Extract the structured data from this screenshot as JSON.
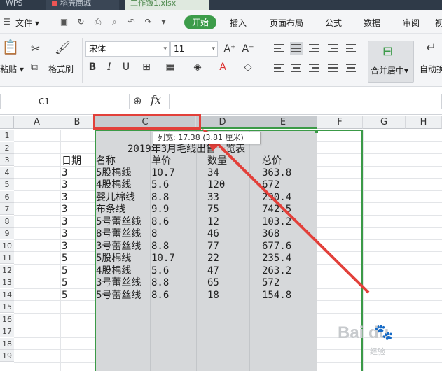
{
  "tabs": [
    {
      "label": "WPS"
    },
    {
      "label": "稻壳商城"
    },
    {
      "label": "工作簿1.xlsx"
    }
  ],
  "menu": {
    "file": "文件",
    "start": "开始",
    "insert": "插入",
    "page_layout": "页面布局",
    "formula": "公式",
    "data": "数据",
    "review": "审阅",
    "view": "视"
  },
  "ribbon": {
    "paste": "粘贴",
    "format_painter": "格式刷",
    "font_name": "宋体",
    "font_size": "11",
    "bold": "B",
    "italic": "I",
    "underline": "U",
    "merge_center": "合并居中",
    "auto_wrap": "自动换"
  },
  "formula_bar": {
    "name_box": "C1",
    "fx": "fx"
  },
  "columns": [
    "A",
    "B",
    "C",
    "D",
    "E",
    "F",
    "G",
    "H"
  ],
  "rows": [
    "1",
    "2",
    "3",
    "4",
    "5",
    "6",
    "7",
    "8",
    "9",
    "10",
    "11",
    "12",
    "13",
    "14",
    "15",
    "16",
    "17",
    "18",
    "19"
  ],
  "tooltip": "列宽: 17.38 (3.81 厘米)",
  "sheet": {
    "title": "2019年3月毛线出售一览表",
    "headers": [
      "日期",
      "名称",
      "单价",
      "数量",
      "总价"
    ],
    "data": [
      [
        "3",
        "5股棉线",
        "10.7",
        "34",
        "363.8"
      ],
      [
        "3",
        "4股棉线",
        "5.6",
        "120",
        "672"
      ],
      [
        "3",
        "婴儿棉线",
        "8.8",
        "33",
        "290.4"
      ],
      [
        "3",
        "布条线",
        "9.9",
        "75",
        "742.5"
      ],
      [
        "3",
        "5号蕾丝线",
        "8.6",
        "12",
        "103.2"
      ],
      [
        "3",
        "8号蕾丝线",
        "8",
        "46",
        "368"
      ],
      [
        "3",
        "3号蕾丝线",
        "8.8",
        "77",
        "677.6"
      ],
      [
        "5",
        "5股棉线",
        "10.7",
        "22",
        "235.4"
      ],
      [
        "5",
        "4股棉线",
        "5.6",
        "47",
        "263.2"
      ],
      [
        "5",
        "3号蕾丝线",
        "8.8",
        "65",
        "572"
      ],
      [
        "5",
        "5号蕾丝线",
        "8.6",
        "18",
        "154.8"
      ]
    ]
  },
  "watermark": {
    "brand": "Bai du",
    "sub": "经验"
  },
  "colors": {
    "accent_green": "#3b9a47",
    "highlight_red": "#e2403a"
  }
}
